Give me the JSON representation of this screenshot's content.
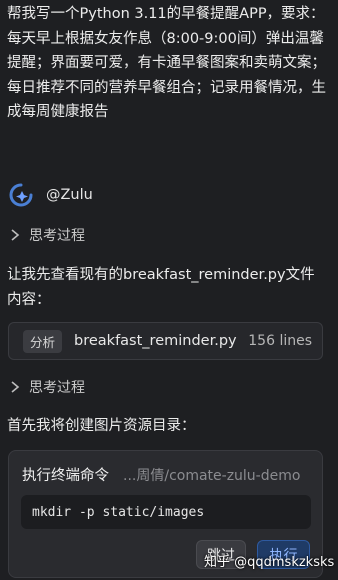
{
  "prompt": "帮我写一个Python 3.11的早餐提醒APP，要求：每天早上根据女友作息（8:00-9:00间）弹出温馨提醒；界面要可爱，有卡通早餐图案和卖萌文案；每日推荐不同的营养早餐组合；记录用餐情况，生成每周健康报告",
  "agent": {
    "name": "@Zulu",
    "avatar_icon": "zulu-logo-icon"
  },
  "thinking_label": "思考过程",
  "messages": {
    "check_file": "让我先查看现有的breakfast_reminder.py文件内容：",
    "create_dir": "首先我将创建图片资源目录："
  },
  "file_card": {
    "tag": "分析",
    "file_name": "breakfast_reminder.py",
    "lines": "156 lines"
  },
  "terminal": {
    "title": "执行终端命令",
    "path": "...周倩/comate-zulu-demo",
    "command": "mkdir -p static/images",
    "skip_label": "跳过",
    "run_label": "执行"
  },
  "watermark": "知乎 @qqdmskzksks",
  "colors": {
    "background": "#1e1f22",
    "card": "#26272b",
    "accent": "#4a7fd4",
    "run_button_text": "#8fb6ff"
  }
}
